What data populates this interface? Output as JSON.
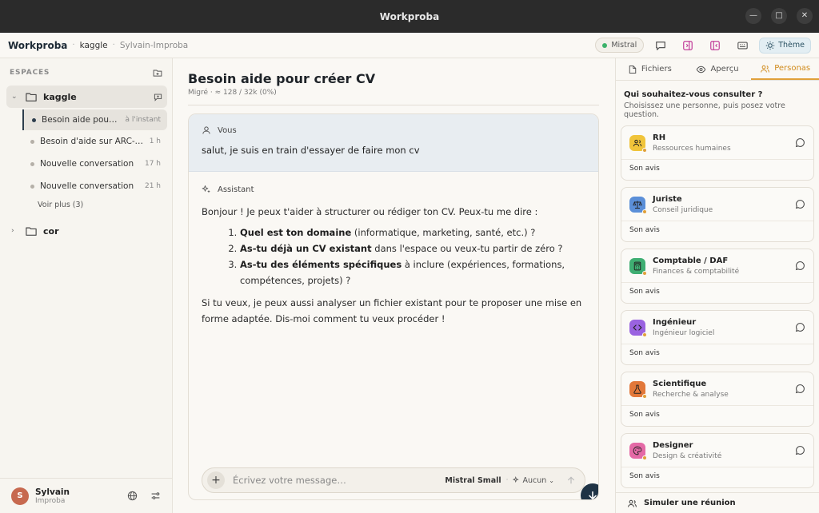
{
  "window": {
    "title": "Workproba"
  },
  "topbar": {
    "brand": "Workproba",
    "breadcrumb_space": "kaggle",
    "breadcrumb_user": "Sylvain-Improba",
    "model": "Mistral",
    "theme_label": "Thème"
  },
  "sidebar": {
    "heading": "ESPACES",
    "spaces": [
      {
        "name": "kaggle",
        "conversations": [
          {
            "title": "Besoin aide pour créer CV",
            "time": "à l'instant"
          },
          {
            "title": "Besoin d'aide sur ARC-AGI",
            "time": "1 h"
          },
          {
            "title": "Nouvelle conversation",
            "time": "17 h"
          },
          {
            "title": "Nouvelle conversation",
            "time": "21 h"
          }
        ],
        "more": "Voir plus (3)"
      },
      {
        "name": "cor"
      }
    ],
    "user": {
      "initial": "S",
      "name": "Sylvain",
      "org": "Improba"
    }
  },
  "conversation": {
    "title": "Besoin aide pour créer CV",
    "meta": "Migré · ≈ 128 / 32k (0%)",
    "user_role": "Vous",
    "user_message": "salut, je suis en train d'essayer de faire mon cv",
    "assistant_role": "Assistant",
    "assistant_intro": "Bonjour ! Je peux t'aider à structurer ou rédiger ton CV. Peux-tu me dire :",
    "assistant_list": [
      {
        "bold": "Quel est ton domaine",
        "rest": " (informatique, marketing, santé, etc.) ?"
      },
      {
        "bold": "As-tu déjà un CV existant",
        "rest": " dans l'espace ou veux-tu partir de zéro ?"
      },
      {
        "bold": "As-tu des éléments spécifiques",
        "rest": " à inclure (expériences, formations, compétences, projets) ?"
      }
    ],
    "assistant_outro": "Si tu veux, je peux aussi analyser un fichier existant pour te proposer une mise en forme adaptée. Dis-moi comment tu veux procéder !"
  },
  "composer": {
    "placeholder": "Écrivez votre message…",
    "model": "Mistral Small",
    "tools": "Aucun"
  },
  "right_panel": {
    "tabs": [
      "Fichiers",
      "Aperçu",
      "Personas"
    ],
    "active_tab": "Personas",
    "question": "Qui souhaitez-vous consulter ?",
    "subtitle": "Choisissez une personne, puis posez votre question.",
    "personas": [
      {
        "name": "RH",
        "desc": "Ressources humaines",
        "avis": "Son avis",
        "color": "#f0c43a",
        "icon": "people-icon"
      },
      {
        "name": "Juriste",
        "desc": "Conseil juridique",
        "avis": "Son avis",
        "color": "#5b8fd8",
        "icon": "scales-icon"
      },
      {
        "name": "Comptable / DAF",
        "desc": "Finances & comptabilité",
        "avis": "Son avis",
        "color": "#3fae72",
        "icon": "calculator-icon"
      },
      {
        "name": "Ingénieur",
        "desc": "Ingénieur logiciel",
        "avis": "Son avis",
        "color": "#9a63e0",
        "icon": "code-icon"
      },
      {
        "name": "Scientifique",
        "desc": "Recherche & analyse",
        "avis": "Son avis",
        "color": "#e2783a",
        "icon": "flask-icon"
      },
      {
        "name": "Designer",
        "desc": "Design & créativité",
        "avis": "Son avis",
        "color": "#e46aa6",
        "icon": "palette-icon"
      }
    ],
    "simulate": "Simuler une réunion"
  }
}
